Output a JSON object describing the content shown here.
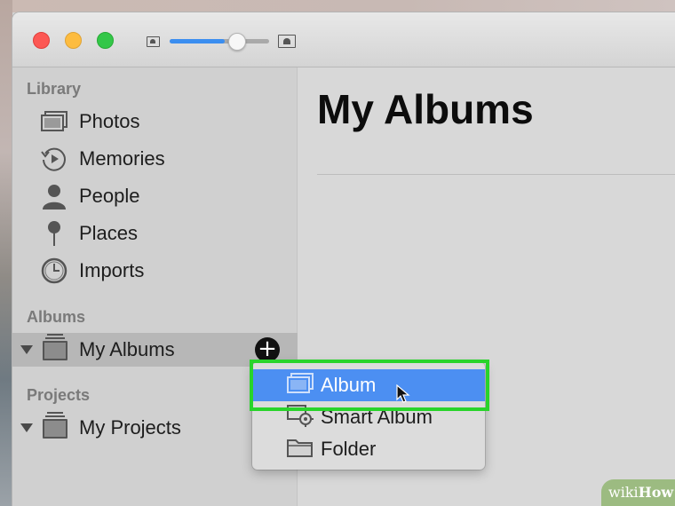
{
  "sidebar": {
    "library_heading": "Library",
    "library_items": [
      {
        "label": "Photos",
        "icon": "photos-icon"
      },
      {
        "label": "Memories",
        "icon": "memories-icon"
      },
      {
        "label": "People",
        "icon": "people-icon"
      },
      {
        "label": "Places",
        "icon": "places-icon"
      },
      {
        "label": "Imports",
        "icon": "imports-icon"
      }
    ],
    "albums_heading": "Albums",
    "albums_item": "My Albums",
    "add_symbol": "+",
    "projects_heading": "Projects",
    "projects_item": "My Projects"
  },
  "toolbar": {
    "zoom_level": 0.55
  },
  "main": {
    "title": "My Albums"
  },
  "menu": {
    "items": [
      {
        "label": "Album",
        "highlighted": true,
        "icon": "album-icon"
      },
      {
        "label": "Smart Album",
        "highlighted": false,
        "icon": "smart-album-icon"
      },
      {
        "label": "Folder",
        "highlighted": false,
        "icon": "folder-icon"
      }
    ]
  },
  "watermark": {
    "prefix": "wiki",
    "suffix": "How"
  },
  "colors": {
    "highlight_box": "#29d42b",
    "menu_selection": "#4c8ff2",
    "accent": "#3b8ef0"
  }
}
